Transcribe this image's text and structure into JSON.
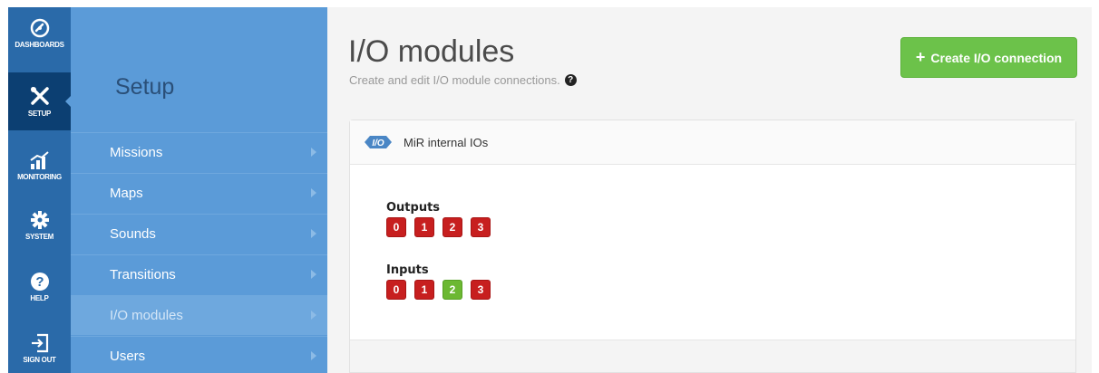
{
  "rail": {
    "items": [
      {
        "label": "DASHBOARDS",
        "icon": "dashboard-gauge-icon"
      },
      {
        "label": "SETUP",
        "icon": "tools-icon"
      },
      {
        "label": "MONITORING",
        "icon": "monitoring-chart-icon"
      },
      {
        "label": "SYSTEM",
        "icon": "gear-icon"
      },
      {
        "label": "HELP",
        "icon": "help-icon"
      },
      {
        "label": "SIGN OUT",
        "icon": "sign-out-icon"
      }
    ],
    "active": "SETUP"
  },
  "subnav": {
    "title": "Setup",
    "items": [
      {
        "label": "Missions"
      },
      {
        "label": "Maps"
      },
      {
        "label": "Sounds"
      },
      {
        "label": "Transitions"
      },
      {
        "label": "I/O modules"
      },
      {
        "label": "Users"
      }
    ],
    "active": "I/O modules"
  },
  "page": {
    "title": "I/O modules",
    "subtitle": "Create and edit I/O module connections.",
    "help_glyph": "?",
    "create_button": "Create I/O connection",
    "create_button_plus": "+"
  },
  "panel": {
    "badge_text": "I/O",
    "title": "MiR internal IOs",
    "outputs": {
      "label": "Outputs",
      "pins": [
        {
          "label": "0",
          "state": "off"
        },
        {
          "label": "1",
          "state": "off"
        },
        {
          "label": "2",
          "state": "off"
        },
        {
          "label": "3",
          "state": "off"
        }
      ]
    },
    "inputs": {
      "label": "Inputs",
      "pins": [
        {
          "label": "0",
          "state": "off"
        },
        {
          "label": "1",
          "state": "off"
        },
        {
          "label": "2",
          "state": "on"
        },
        {
          "label": "3",
          "state": "off"
        }
      ]
    }
  },
  "colors": {
    "rail": "#2a6aa9",
    "rail_active": "#0c3f72",
    "subnav": "#5b9bd8",
    "create_button": "#6cc24a",
    "pin_off": "#c71f1f",
    "pin_on": "#6cb832"
  }
}
